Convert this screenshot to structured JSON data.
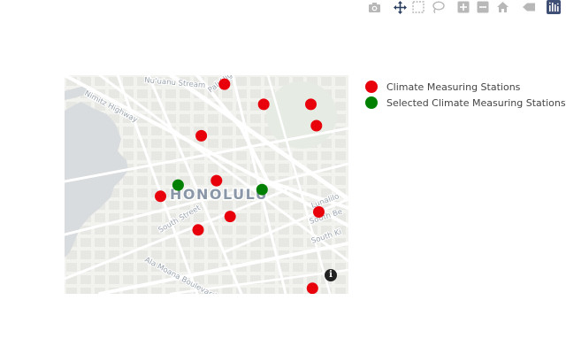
{
  "modebar": {
    "buttons": [
      {
        "name": "camera-icon",
        "title": "Download plot as a png"
      },
      {
        "name": "pan-icon",
        "title": "Pan"
      },
      {
        "name": "box-select-icon",
        "title": "Box Select"
      },
      {
        "name": "lasso-select-icon",
        "title": "Lasso Select"
      },
      {
        "name": "zoom-in-icon",
        "title": "Zoom in"
      },
      {
        "name": "zoom-out-icon",
        "title": "Zoom out"
      },
      {
        "name": "home-icon",
        "title": "Reset view"
      },
      {
        "name": "hover-icon",
        "title": "Toggle hover"
      },
      {
        "name": "plotly-logo-icon",
        "title": "Produced with Plotly"
      }
    ],
    "active_color": "#2a3f5f",
    "icon_color": "#b8b8b8"
  },
  "map": {
    "city_label": "HONOLULU",
    "street_labels": [
      "Nuʻuanu Stream",
      "Nimitz Highway",
      "Pali Highway",
      "South Street",
      "Lunalilo",
      "South Be",
      "South Ki",
      "Ala Moana Boulevard"
    ],
    "water_color": "#d9dcde",
    "land_color": "#f2f2ef",
    "road_color": "#ffffff",
    "park_color": "#e6ece4"
  },
  "legend": {
    "items": [
      {
        "label": "Climate Measuring Stations",
        "color": "#e8000b"
      },
      {
        "label": "Selected Climate Measuring Stations",
        "color": "#008000"
      }
    ]
  },
  "markers": {
    "climate_stations": [
      {
        "lon": -157.856,
        "lat": 21.3182
      },
      {
        "lon": -157.8589,
        "lat": 21.3136
      },
      {
        "lon": -157.8511,
        "lat": 21.3164
      },
      {
        "lon": -157.8452,
        "lat": 21.3164
      },
      {
        "lon": -157.8445,
        "lat": 21.3145
      },
      {
        "lon": -157.857,
        "lat": 21.3096
      },
      {
        "lon": -157.864,
        "lat": 21.3082
      },
      {
        "lon": -157.8553,
        "lat": 21.3064
      },
      {
        "lon": -157.8593,
        "lat": 21.3052
      },
      {
        "lon": -157.8442,
        "lat": 21.3068
      },
      {
        "lon": -157.845,
        "lat": 21.3
      }
    ],
    "selected_stations": [
      {
        "lon": -157.8618,
        "lat": 21.3092
      },
      {
        "lon": -157.8513,
        "lat": 21.3088
      }
    ]
  },
  "map_bounds": {
    "lon_min": -157.876,
    "lon_max": -157.8405,
    "lat_min": 21.2995,
    "lat_max": 21.319
  },
  "info_icon_glyph": "i"
}
